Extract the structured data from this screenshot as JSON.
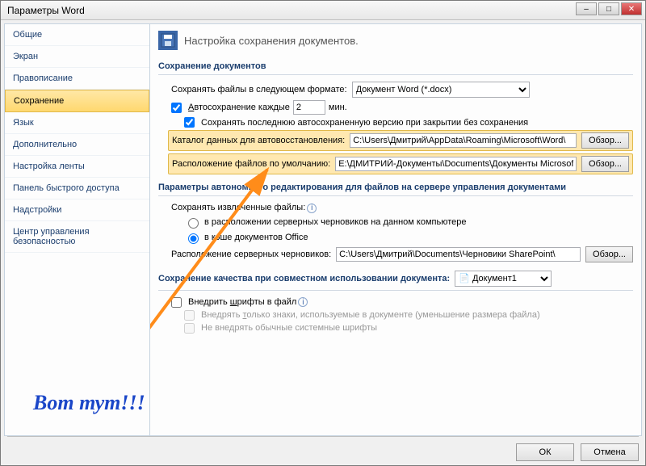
{
  "window": {
    "title": "Параметры Word"
  },
  "sidebar": {
    "items": [
      {
        "label": "Общие"
      },
      {
        "label": "Экран"
      },
      {
        "label": "Правописание"
      },
      {
        "label": "Сохранение",
        "selected": true
      },
      {
        "label": "Язык"
      },
      {
        "label": "Дополнительно"
      },
      {
        "label": "Настройка ленты"
      },
      {
        "label": "Панель быстрого доступа"
      },
      {
        "label": "Надстройки"
      },
      {
        "label": "Центр управления безопасностью"
      }
    ]
  },
  "header": {
    "title": "Настройка сохранения документов."
  },
  "sec1": {
    "title": "Сохранение документов",
    "save_format_label": "Сохранять файлы в следующем формате:",
    "save_format_value": "Документ Word (*.docx)",
    "autosave_label": "Автосохранение каждые",
    "autosave_value": "2",
    "autosave_unit": "мин.",
    "keep_last_label": "Сохранять последнюю автосохраненную версию при закрытии без сохранения",
    "autorec_label": "Каталог данных для автовосстановления:",
    "autorec_value": "C:\\Users\\Дмитрий\\AppData\\Roaming\\Microsoft\\Word\\",
    "defaultloc_label": "Расположение файлов по умолчанию:",
    "defaultloc_value": "E:\\ДМИТРИЙ-Документы\\Documents\\Документы Microsoft Word",
    "browse": "Обзор..."
  },
  "sec2": {
    "title": "Параметры автономного редактирования для файлов на сервере управления документами",
    "save_checked_label": "Сохранять извлеченные файлы:",
    "opt1": "в расположении серверных черновиков на данном компьютере",
    "opt2": "в кэше документов Office",
    "drafts_label": "Расположение серверных черновиков:",
    "drafts_value": "C:\\Users\\Дмитрий\\Documents\\Черновики SharePoint\\",
    "browse": "Обзор..."
  },
  "sec3": {
    "title": "Сохранение качества при совместном использовании документа:",
    "doc_value": "Документ1",
    "embed_label": "Внедрить шрифты в файл",
    "embed_only_label": "Внедрять только знаки, используемые в документе (уменьшение размера файла)",
    "not_embed_label": "Не внедрять обычные системные шрифты"
  },
  "buttons": {
    "ok": "ОК",
    "cancel": "Отмена"
  },
  "annotation": {
    "text": "Вот тут!!!"
  }
}
